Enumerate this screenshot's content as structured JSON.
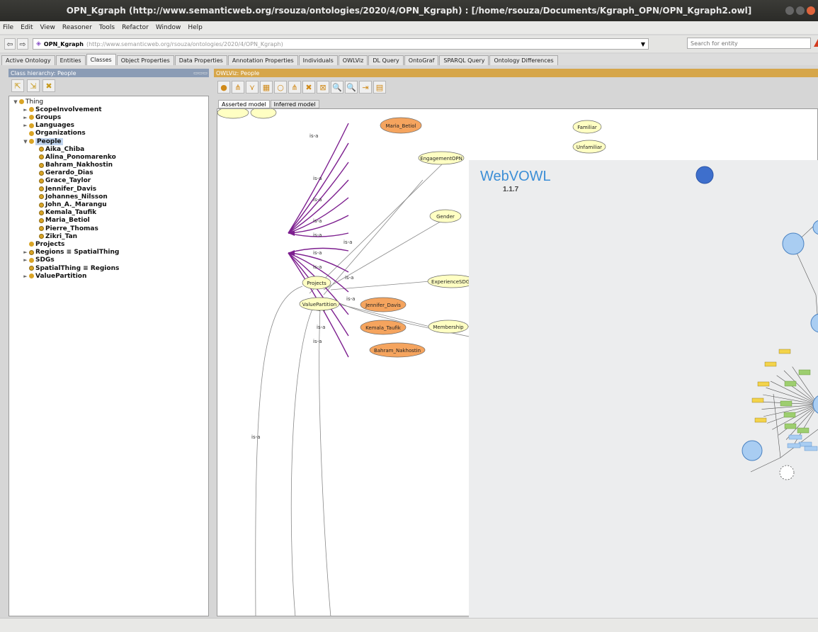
{
  "window": {
    "title": "OPN_Kgraph (http://www.semanticweb.org/rsouza/ontologies/2020/4/OPN_Kgraph) : [/home/rsouza/Documents/Kgraph_OPN/OPN_Kgraph2.owl]"
  },
  "menu": [
    "File",
    "Edit",
    "View",
    "Reasoner",
    "Tools",
    "Refactor",
    "Window",
    "Help"
  ],
  "address": {
    "ontology_name": "OPN_Kgraph",
    "ontology_iri": "(http://www.semanticweb.org/rsouza/ontologies/2020/4/OPN_Kgraph)",
    "search_placeholder": "Search for entity"
  },
  "tabs": [
    "Active Ontology",
    "Entities",
    "Classes",
    "Object Properties",
    "Data Properties",
    "Annotation Properties",
    "Individuals",
    "OWLViz",
    "DL Query",
    "OntoGraf",
    "SPARQL Query",
    "Ontology Differences"
  ],
  "active_tab": "Classes",
  "left_pane": {
    "header": "Class hierarchy: People",
    "tree": [
      {
        "label": "Thing",
        "level": 0,
        "expander": "▼",
        "kind": "class",
        "root": true
      },
      {
        "label": "ScopeInvolvement",
        "level": 1,
        "expander": "►",
        "kind": "class"
      },
      {
        "label": "Groups",
        "level": 1,
        "expander": "►",
        "kind": "class"
      },
      {
        "label": "Languages",
        "level": 1,
        "expander": "►",
        "kind": "class"
      },
      {
        "label": "Organizations",
        "level": 1,
        "expander": "",
        "kind": "class"
      },
      {
        "label": "People",
        "level": 1,
        "expander": "▼",
        "kind": "class",
        "selected": true
      },
      {
        "label": "Aika_Chiba",
        "level": 2,
        "expander": "",
        "kind": "individual"
      },
      {
        "label": "Alina_Ponomarenko",
        "level": 2,
        "expander": "",
        "kind": "individual"
      },
      {
        "label": "Bahram_Nakhostin",
        "level": 2,
        "expander": "",
        "kind": "individual"
      },
      {
        "label": "Gerardo_Dias",
        "level": 2,
        "expander": "",
        "kind": "individual"
      },
      {
        "label": "Grace_Taylor",
        "level": 2,
        "expander": "",
        "kind": "individual"
      },
      {
        "label": "Jennifer_Davis",
        "level": 2,
        "expander": "",
        "kind": "individual"
      },
      {
        "label": "Johannes_Nilsson",
        "level": 2,
        "expander": "",
        "kind": "individual"
      },
      {
        "label": "John_A._Marangu",
        "level": 2,
        "expander": "",
        "kind": "individual"
      },
      {
        "label": "Kemala_Taufik",
        "level": 2,
        "expander": "",
        "kind": "individual"
      },
      {
        "label": "Maria_Betiol",
        "level": 2,
        "expander": "",
        "kind": "individual"
      },
      {
        "label": "Pierre_Thomas",
        "level": 2,
        "expander": "",
        "kind": "individual"
      },
      {
        "label": "Zikri_Tan",
        "level": 2,
        "expander": "",
        "kind": "individual"
      },
      {
        "label": "Projects",
        "level": 1,
        "expander": "",
        "kind": "class"
      },
      {
        "label": "Regions ≡ SpatialThing",
        "level": 1,
        "expander": "►",
        "kind": "individual"
      },
      {
        "label": "SDGs",
        "level": 1,
        "expander": "►",
        "kind": "class"
      },
      {
        "label": "SpatialThing ≡ Regions",
        "level": 1,
        "expander": "",
        "kind": "individual"
      },
      {
        "label": "ValuePartition",
        "level": 1,
        "expander": "►",
        "kind": "class"
      }
    ]
  },
  "right_pane": {
    "header": "OWLViz: People",
    "model_tabs": [
      "Asserted model",
      "Inferred model"
    ],
    "active_model": "Asserted model",
    "graph": {
      "edge_label": "is-a",
      "nodes": [
        {
          "label": "Maria_Betiol",
          "type": "individual"
        },
        {
          "label": "Familiar",
          "type": "class"
        },
        {
          "label": "Unfamiliar",
          "type": "class"
        },
        {
          "label": "EngagementOPN",
          "type": "class"
        },
        {
          "label": "Gender",
          "type": "class"
        },
        {
          "label": "ExperienceSDGs",
          "type": "class"
        },
        {
          "label": "Projects",
          "type": "class"
        },
        {
          "label": "ValuePartition",
          "type": "class"
        },
        {
          "label": "Jennifer_Davis",
          "type": "individual"
        },
        {
          "label": "Kemala_Taufik",
          "type": "individual"
        },
        {
          "label": "Membership",
          "type": "class"
        },
        {
          "label": "Bahram_Nakhostin",
          "type": "individual"
        }
      ]
    }
  },
  "webvowl": {
    "title": "WebVOWL",
    "version": "1.1.7"
  },
  "colors": {
    "class_node": "#ffffc3",
    "individual_node": "#f5a45e",
    "isa_edge": "#7d1f8f",
    "owlviz_header": "#d6a64a",
    "hierarchy_header": "#8b9cb5",
    "webvowl_blue": "#3b8ed6",
    "webvowl_bg": "#ecedee"
  }
}
